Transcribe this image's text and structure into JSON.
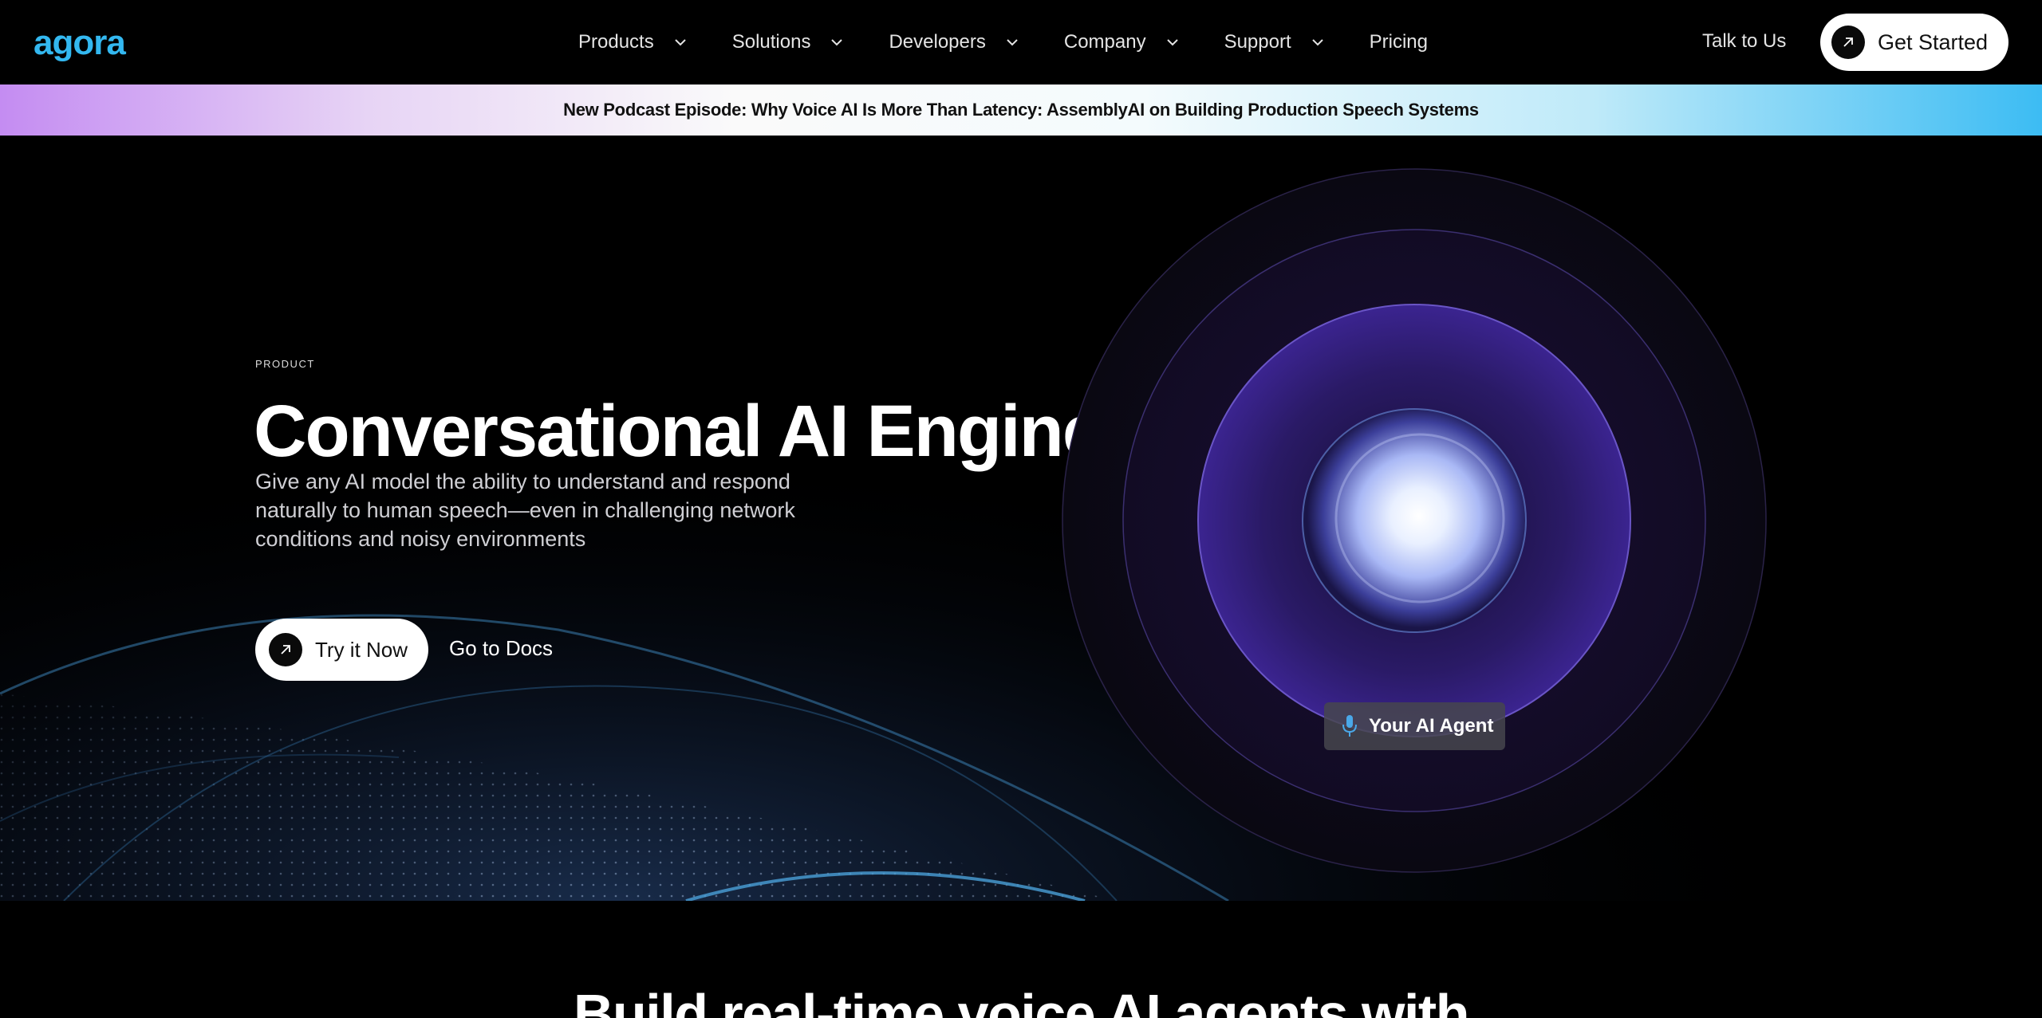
{
  "brand": {
    "logo_text": "agora",
    "accent": "#33b8f0"
  },
  "nav": {
    "items": [
      {
        "label": "Products",
        "has_dropdown": true
      },
      {
        "label": "Solutions",
        "has_dropdown": true
      },
      {
        "label": "Developers",
        "has_dropdown": true
      },
      {
        "label": "Company",
        "has_dropdown": true
      },
      {
        "label": "Support",
        "has_dropdown": true
      },
      {
        "label": "Pricing",
        "has_dropdown": false
      }
    ],
    "talk_label": "Talk to Us",
    "cta_label": "Get Started"
  },
  "banner": {
    "text": "New Podcast Episode: Why Voice AI Is More Than Latency: AssemblyAI on Building Production Speech Systems"
  },
  "hero": {
    "eyebrow": "PRODUCT",
    "title": "Conversational AI Engine",
    "subtitle": "Give any AI model the ability to understand and respond naturally to human speech—even in challenging network conditions and noisy environments",
    "primary_cta": "Try it Now",
    "secondary_cta": "Go to Docs",
    "agent_badge": "Your AI Agent"
  },
  "next_section": {
    "heading": "Build real-time voice AI agents with"
  }
}
